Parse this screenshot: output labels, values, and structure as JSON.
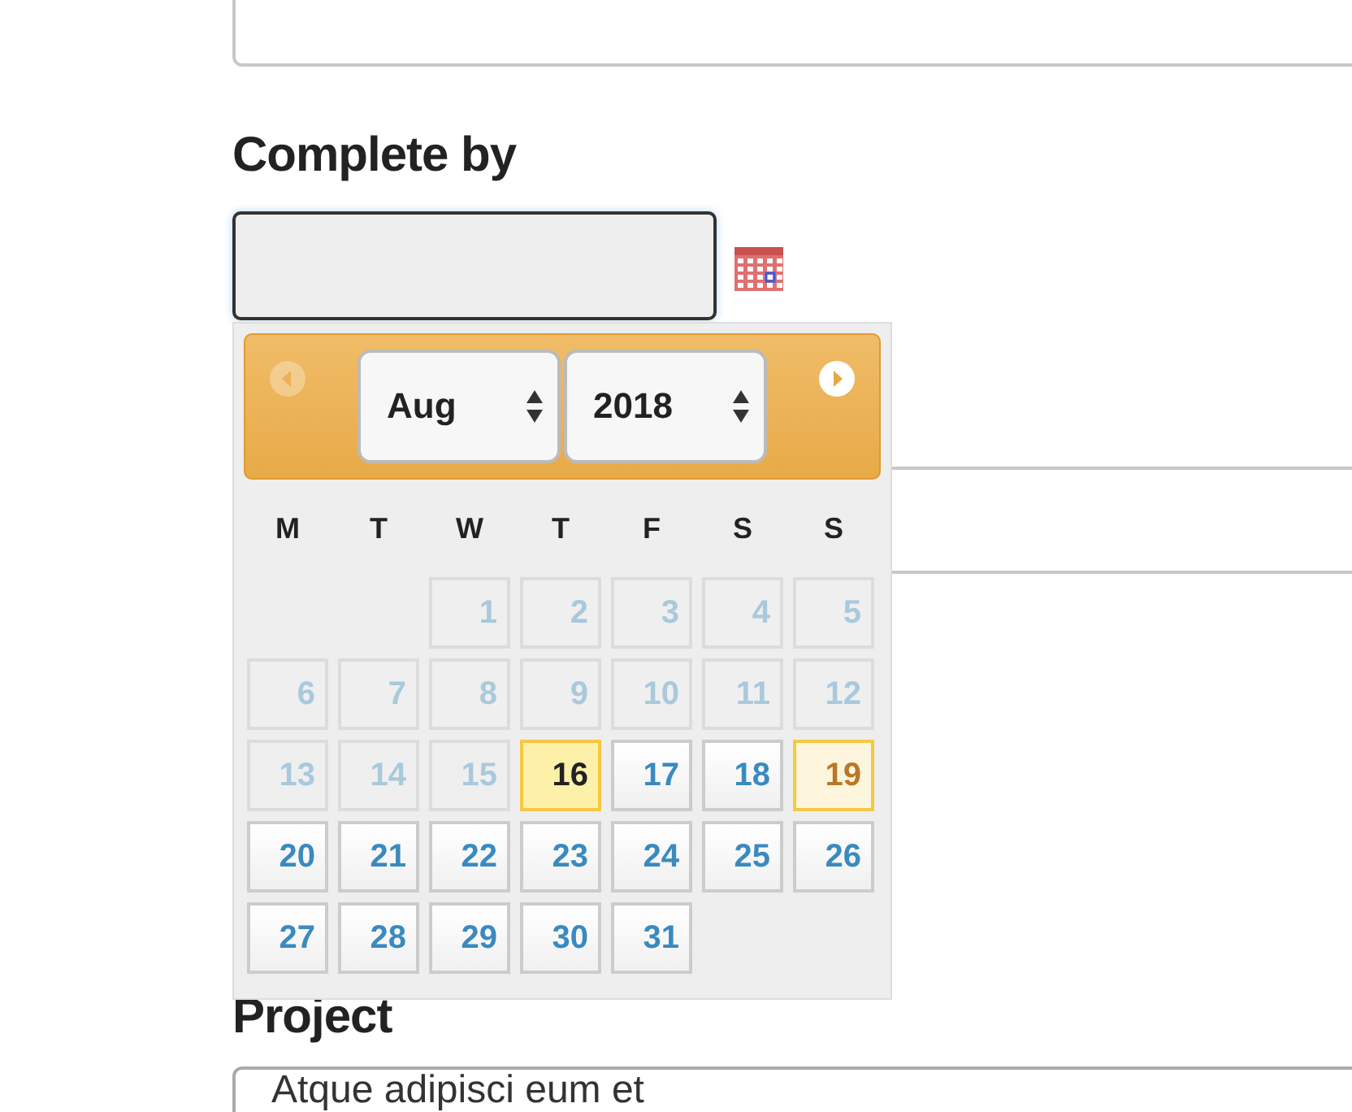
{
  "top_field": {
    "kind": "text"
  },
  "complete_by": {
    "label": "Complete by",
    "input": {
      "focused": true
    }
  },
  "datepicker": {
    "prev": {
      "disabled": true
    },
    "next": {
      "disabled": false
    },
    "month": "Aug",
    "year": "2018",
    "weekdays": [
      "M",
      "T",
      "W",
      "T",
      "F",
      "S",
      "S"
    ],
    "weeks": [
      {
        "kind": "padded",
        "days": [
          {
            "label": "1",
            "disabled": true,
            "today": false,
            "selected": false
          },
          {
            "label": "2",
            "disabled": true,
            "today": false,
            "selected": false
          },
          {
            "label": "3",
            "disabled": true,
            "today": false,
            "selected": false
          },
          {
            "label": "4",
            "disabled": true,
            "today": false,
            "selected": false
          },
          {
            "label": "5",
            "disabled": true,
            "today": false,
            "selected": false
          }
        ]
      },
      {
        "kind": "full",
        "days": [
          {
            "label": "6",
            "disabled": true,
            "today": false,
            "selected": false
          },
          {
            "label": "7",
            "disabled": true,
            "today": false,
            "selected": false
          },
          {
            "label": "8",
            "disabled": true,
            "today": false,
            "selected": false
          },
          {
            "label": "9",
            "disabled": true,
            "today": false,
            "selected": false
          },
          {
            "label": "10",
            "disabled": true,
            "today": false,
            "selected": false
          },
          {
            "label": "11",
            "disabled": true,
            "today": false,
            "selected": false
          },
          {
            "label": "12",
            "disabled": true,
            "today": false,
            "selected": false
          }
        ]
      },
      {
        "kind": "full",
        "days": [
          {
            "label": "13",
            "disabled": true,
            "today": false,
            "selected": false
          },
          {
            "label": "14",
            "disabled": true,
            "today": false,
            "selected": false
          },
          {
            "label": "15",
            "disabled": true,
            "today": false,
            "selected": false
          },
          {
            "label": "16",
            "disabled": false,
            "today": true,
            "selected": false
          },
          {
            "label": "17",
            "disabled": false,
            "today": false,
            "selected": false
          },
          {
            "label": "18",
            "disabled": false,
            "today": false,
            "selected": false
          },
          {
            "label": "19",
            "disabled": false,
            "today": false,
            "selected": true
          }
        ]
      },
      {
        "kind": "full",
        "days": [
          {
            "label": "20",
            "disabled": false,
            "today": false,
            "selected": false
          },
          {
            "label": "21",
            "disabled": false,
            "today": false,
            "selected": false
          },
          {
            "label": "22",
            "disabled": false,
            "today": false,
            "selected": false
          },
          {
            "label": "23",
            "disabled": false,
            "today": false,
            "selected": false
          },
          {
            "label": "24",
            "disabled": false,
            "today": false,
            "selected": false
          },
          {
            "label": "25",
            "disabled": false,
            "today": false,
            "selected": false
          },
          {
            "label": "26",
            "disabled": false,
            "today": false,
            "selected": false
          }
        ]
      },
      {
        "kind": "full",
        "days": [
          {
            "label": "27",
            "disabled": false,
            "today": false,
            "selected": false
          },
          {
            "label": "28",
            "disabled": false,
            "today": false,
            "selected": false
          },
          {
            "label": "29",
            "disabled": false,
            "today": false,
            "selected": false
          },
          {
            "label": "30",
            "disabled": false,
            "today": false,
            "selected": false
          },
          {
            "label": "31",
            "disabled": false,
            "today": false,
            "selected": false
          }
        ]
      }
    ]
  },
  "project": {
    "label": "Project",
    "value": "Atque adipisci eum et"
  }
}
